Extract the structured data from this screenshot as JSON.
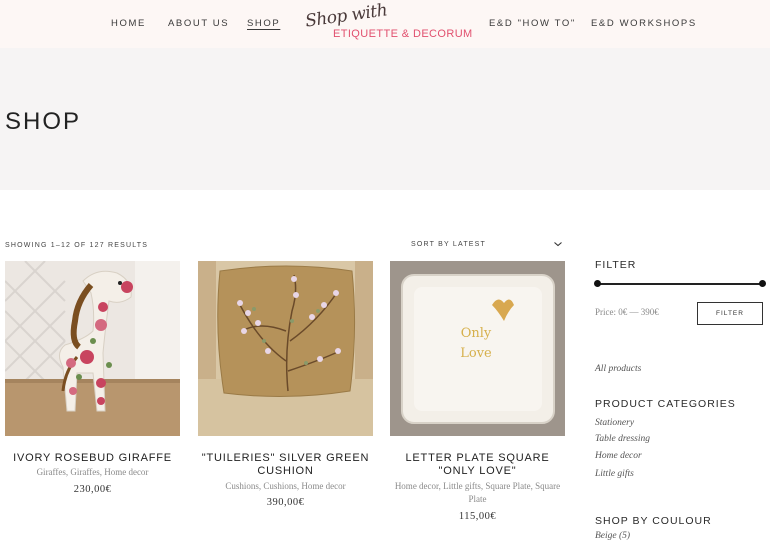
{
  "header": {
    "nav_left": [
      "HOME",
      "ABOUT US",
      "SHOP"
    ],
    "nav_right": [
      "E&D \"HOW TO\"",
      "E&D WORKSHOPS"
    ],
    "logo_script": "Shop with",
    "logo_main": "ETIQUETTE & DECORUM",
    "active_item": "SHOP"
  },
  "hero": {
    "title": "SHOP"
  },
  "toolbar": {
    "result_count": "SHOWING 1–12 OF 127 RESULTS",
    "sort_selected": "SORT BY LATEST"
  },
  "products": [
    {
      "title": "IVORY ROSEBUD GIRAFFE",
      "categories": "Giraffes, Giraffes, Home decor",
      "price": "230,00€"
    },
    {
      "title": "\"TUILERIES\" SILVER GREEN CUSHION",
      "categories": "Cushions, Cushions, Home decor",
      "price": "390,00€"
    },
    {
      "title": "LETTER PLATE SQUARE \"ONLY LOVE\"",
      "categories": "Home decor, Little gifts, Square Plate, Square Plate",
      "price": "115,00€",
      "plate_text": "Only Love"
    }
  ],
  "sidebar": {
    "filter_heading": "FILTER",
    "price_text": "Price: 0€ — 390€",
    "filter_button": "FILTER",
    "all_products": "All products",
    "categories_heading": "PRODUCT CATEGORIES",
    "categories": [
      "Stationery",
      "Table dressing",
      "Home decor",
      "Little gifts"
    ],
    "colour_heading": "SHOP BY COULOUR",
    "colours": [
      "Beige (5)"
    ]
  },
  "colors": {
    "header_bg": "#fdf7f5",
    "hero_bg": "#f6f4f4",
    "logo_accent": "#e1506e"
  }
}
